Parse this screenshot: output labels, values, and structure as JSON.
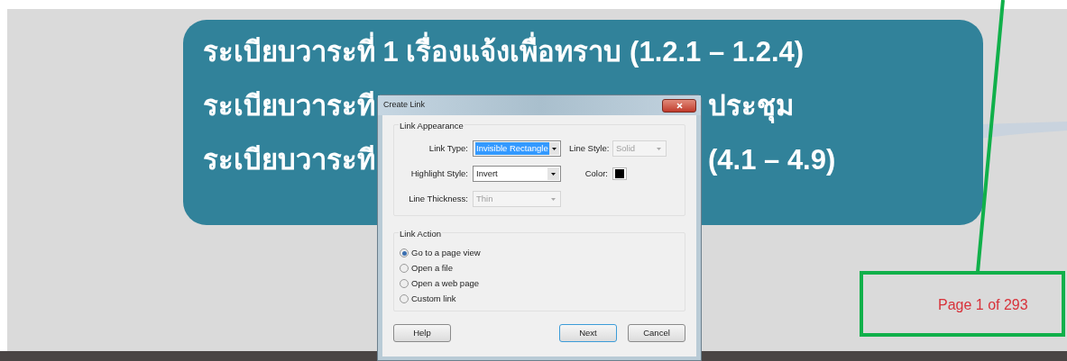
{
  "slide": {
    "lines": [
      {
        "left": "ระเบียบวาระที่ 1  เรื่องแจ้งเพื่อทราบ (1.2.1 – 1.2.4)"
      },
      {
        "left": "ระเบียบวาระที",
        "right": "ประชุม"
      },
      {
        "left": "ระเบียบวาระที",
        "right": "(4.1 – 4.9)"
      }
    ],
    "page_label": "Page 1 of 293"
  },
  "dialog": {
    "title": "Create Link",
    "appearance": {
      "heading": "Link Appearance",
      "rows": [
        [
          {
            "kind": "dropdown",
            "label": "Link Type:",
            "value": "Invisible Rectangle",
            "highlighted": true,
            "disabled": false
          },
          {
            "kind": "dropdown",
            "label": "Line Style:",
            "value": "Solid",
            "highlighted": false,
            "disabled": true
          }
        ],
        [
          {
            "kind": "dropdown",
            "label": "Highlight Style:",
            "value": "Invert",
            "highlighted": false,
            "disabled": false
          },
          {
            "kind": "color",
            "label": "Color:",
            "color": "#000000"
          }
        ],
        [
          {
            "kind": "dropdown",
            "label": "Line Thickness:",
            "value": "Thin",
            "highlighted": false,
            "disabled": true
          }
        ]
      ]
    },
    "action": {
      "heading": "Link Action",
      "options": [
        {
          "label": "Go to a page view",
          "selected": true
        },
        {
          "label": "Open a file",
          "selected": false
        },
        {
          "label": "Open a web page",
          "selected": false
        },
        {
          "label": "Custom link",
          "selected": false
        }
      ]
    },
    "buttons": [
      {
        "label": "Help",
        "default": false
      },
      {
        "label": "Next",
        "default": true
      },
      {
        "label": "Cancel",
        "default": false
      }
    ]
  }
}
